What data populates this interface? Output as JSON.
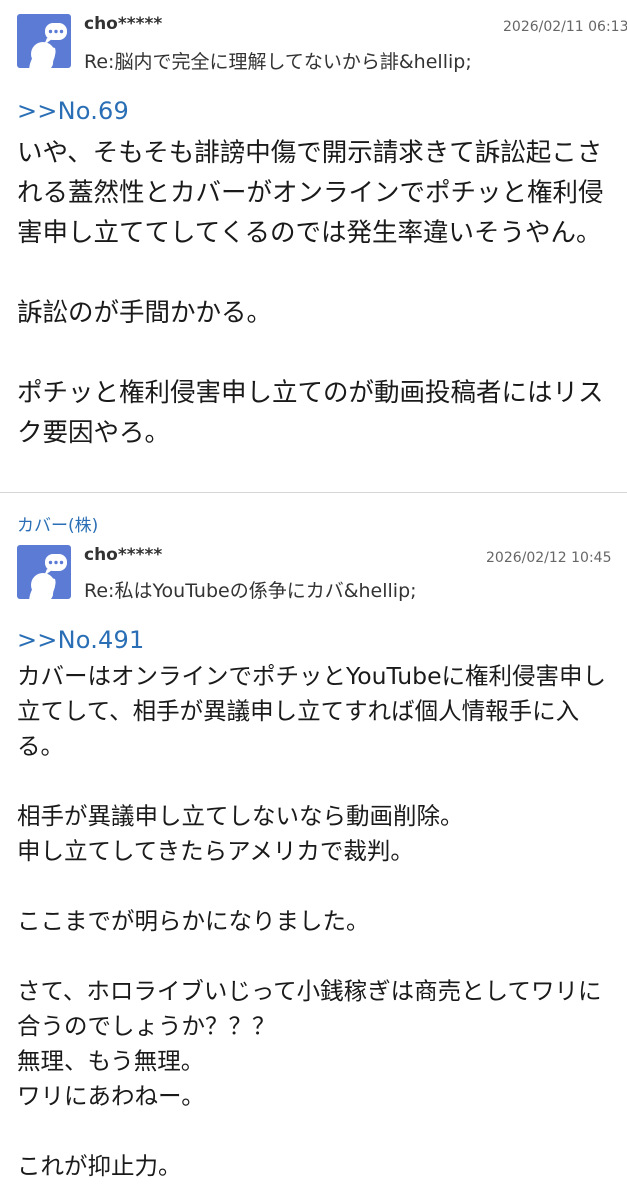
{
  "posts": [
    {
      "username": "cho*****",
      "date": "2026/02/11 06:13",
      "title": "Re:脳内で完全に理解してないから誹&hellip;",
      "anchor": ">>No.69",
      "body": "いや、そもそも誹謗中傷で開示請求きて訴訟起こされる蓋然性とカバーがオンラインでポチッと権利侵害申し立ててしてくるのでは発生率違いそうやん。\n\n訴訟のが手間かかる。\n\nポチッと権利侵害申し立てのが動画投稿者にはリスク要因やろ。"
    },
    {
      "stock": "カバー(株)",
      "username": "cho*****",
      "date": "2026/02/12 10:45",
      "title": "Re:私はYouTubeの係争にカバ&hellip;",
      "anchor": ">>No.491",
      "body": "カバーはオンラインでポチッとYouTubeに権利侵害申し立てして、相手が異議申し立てすれば個人情報手に入る。\n\n相手が異議申し立てしないなら動画削除。\n申し立てしてきたらアメリカで裁判。\n\nここまでが明らかになりました。\n\nさて、ホロライブいじって小銭稼ぎは商売としてワリに合うのでしょうか？？？\n無理、もう無理。\nワリにあわねー。\n\nこれが抑止力。"
    }
  ]
}
